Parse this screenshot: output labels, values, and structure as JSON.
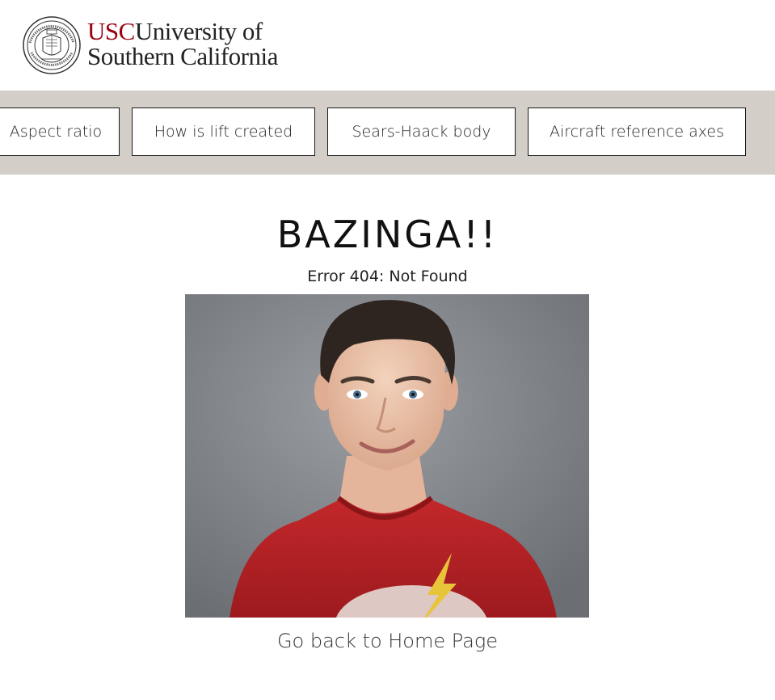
{
  "header": {
    "logo_usc": "USC",
    "logo_line1": "University of",
    "logo_line2": "Southern California"
  },
  "nav": {
    "items": [
      {
        "label": "Aspect ratio"
      },
      {
        "label": "How is lift created"
      },
      {
        "label": "Sears-Haack body"
      },
      {
        "label": "Aircraft reference axes"
      }
    ]
  },
  "main": {
    "title": "BAZINGA!!",
    "subtitle": "Error 404: Not Found",
    "home_link": "Go back to Home Page"
  },
  "colors": {
    "usc_cardinal": "#99000e",
    "nav_background": "#d3cfc8",
    "photo_background": "#7d8085",
    "shirt": "#b01e22"
  },
  "icons": {
    "logo": "usc-seal-icon"
  }
}
